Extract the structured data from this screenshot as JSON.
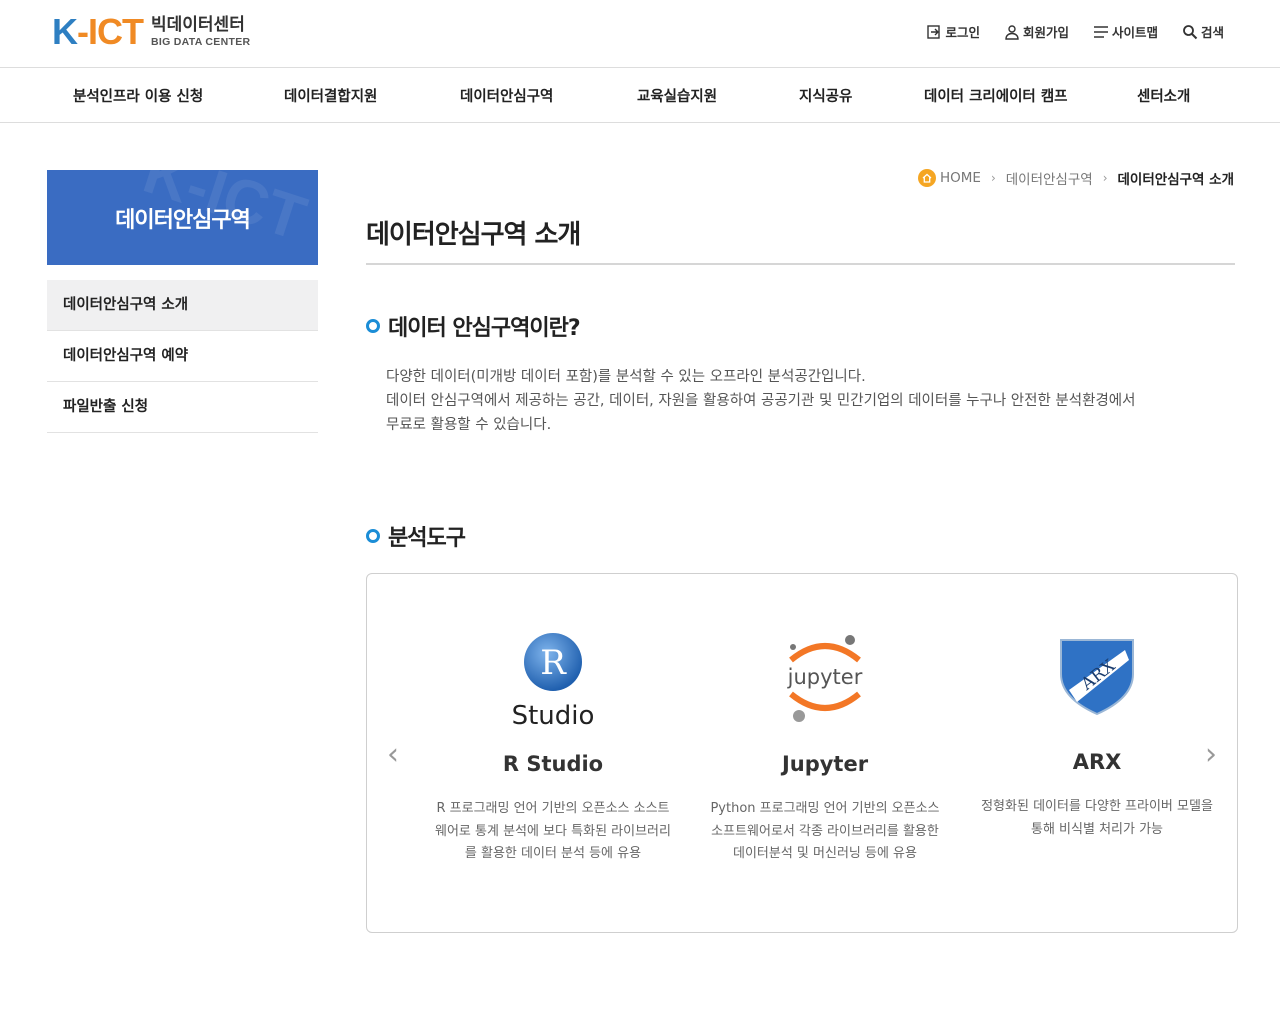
{
  "header": {
    "logo_mark_k": "K",
    "logo_mark_dash": "-",
    "logo_mark_ict": "ICT",
    "logo_ko": "빅데이터센터",
    "logo_en": "BIG DATA CENTER",
    "util": [
      {
        "label": "로그인",
        "icon": "login-icon"
      },
      {
        "label": "회원가입",
        "icon": "user-icon"
      },
      {
        "label": "사이트맵",
        "icon": "menu-icon"
      },
      {
        "label": "검색",
        "icon": "search-icon"
      }
    ]
  },
  "gnb": [
    "분석인프라 이용 신청",
    "데이터결합지원",
    "데이터안심구역",
    "교육실습지원",
    "지식공유",
    "데이터 크리에이터 캠프",
    "센터소개"
  ],
  "lnb": {
    "title": "데이터안심구역",
    "watermark": "K-ICT",
    "items": [
      "데이터안심구역 소개",
      "데이터안심구역 예약",
      "파일반출 신청"
    ]
  },
  "breadcrumb": {
    "home": "HOME",
    "parent": "데이터안심구역",
    "current": "데이터안심구역 소개"
  },
  "page_title": "데이터안심구역 소개",
  "intro": {
    "heading": "데이터 안심구역이란?",
    "line1": "다양한 데이터(미개방 데이터 포함)를 분석할 수 있는 오프라인 분석공간입니다.",
    "line2": "데이터 안심구역에서 제공하는 공간, 데이터, 자원을 활용하여 공공기관 및 민간기업의 데이터를 누구나 안전한 분석환경에서",
    "line3": "무료로 활용할 수 있습니다."
  },
  "tools": {
    "heading": "분석도구",
    "items": [
      {
        "name": "R Studio",
        "logo_letter": "R",
        "logo_word": "Studio",
        "desc": "R 프로그래밍 언어 기반의 오픈소스 소스트웨어로 통계 분석에 보다 특화된 라이브러리를 활용한 데이터 분석 등에 유용"
      },
      {
        "name": "Jupyter",
        "logo_word": "jupyter",
        "desc": "Python 프로그래밍 언어 기반의 오픈소스 소프트웨어로서 각종 라이브러리를 활용한 데이터분석 및 머신러닝 등에 유용"
      },
      {
        "name": "ARX",
        "logo_word": "ARX",
        "desc": "정형화된 데이터를 다양한 프라이버 모델을 통해 비식별 처리가 가능"
      }
    ],
    "prev": "‹",
    "next": "›"
  },
  "colors": {
    "brand_blue": "#3a6cc2",
    "accent_orange": "#f08a24",
    "bullet_blue": "#1b8dd6"
  }
}
